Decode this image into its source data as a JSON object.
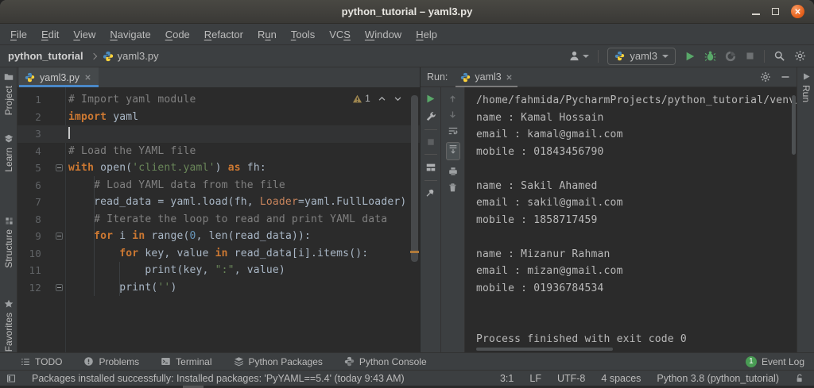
{
  "window": {
    "title": "python_tutorial – yaml3.py"
  },
  "menu": {
    "items": [
      {
        "label": "File",
        "m": 0
      },
      {
        "label": "Edit",
        "m": 0
      },
      {
        "label": "View",
        "m": 0
      },
      {
        "label": "Navigate",
        "m": 0
      },
      {
        "label": "Code",
        "m": 0
      },
      {
        "label": "Refactor",
        "m": 0
      },
      {
        "label": "Run",
        "m": 1
      },
      {
        "label": "Tools",
        "m": 0
      },
      {
        "label": "VCS",
        "m": 2
      },
      {
        "label": "Window",
        "m": 0
      },
      {
        "label": "Help",
        "m": 0
      }
    ]
  },
  "toolbar": {
    "breadcrumb_project": "python_tutorial",
    "breadcrumb_file": "yaml3.py",
    "run_config": "yaml3"
  },
  "left_bar": {
    "items": [
      "Project",
      "Learn",
      "Structure",
      "Favorites"
    ]
  },
  "right_bar": {
    "run_label": "Run"
  },
  "editor": {
    "tab_label": "yaml3.py",
    "inspection_count": "1",
    "lines": [
      {
        "n": "1",
        "segs": [
          [
            "cmt",
            "# Import yaml module"
          ]
        ]
      },
      {
        "n": "2",
        "segs": [
          [
            "kw",
            "import"
          ],
          [
            "def",
            " yaml"
          ]
        ]
      },
      {
        "n": "3",
        "segs": [],
        "current": true,
        "caret": true
      },
      {
        "n": "4",
        "segs": [
          [
            "cmt",
            "# Load the YAML file"
          ]
        ]
      },
      {
        "n": "5",
        "fold": "start",
        "segs": [
          [
            "kw",
            "with"
          ],
          [
            "def",
            " open("
          ],
          [
            "str",
            "'client.yaml'"
          ],
          [
            "def",
            ") "
          ],
          [
            "kw",
            "as"
          ],
          [
            "def",
            " fh:"
          ]
        ]
      },
      {
        "n": "6",
        "segs": [
          [
            "def",
            "    "
          ],
          [
            "cmt",
            "# Load YAML data from the file"
          ]
        ]
      },
      {
        "n": "7",
        "segs": [
          [
            "def",
            "    read_data = yaml.load(fh, "
          ],
          [
            "param",
            "Loader"
          ],
          [
            "def",
            "=yaml.FullLoader)"
          ]
        ]
      },
      {
        "n": "8",
        "segs": [
          [
            "def",
            "    "
          ],
          [
            "cmt",
            "# Iterate the loop to read and print YAML data"
          ]
        ]
      },
      {
        "n": "9",
        "fold": "start",
        "segs": [
          [
            "def",
            "    "
          ],
          [
            "kw",
            "for"
          ],
          [
            "def",
            " i "
          ],
          [
            "kw",
            "in"
          ],
          [
            "def",
            " range("
          ],
          [
            "num",
            "0"
          ],
          [
            "def",
            ", len(read_data)):"
          ]
        ]
      },
      {
        "n": "10",
        "segs": [
          [
            "def",
            "        "
          ],
          [
            "kw",
            "for"
          ],
          [
            "def",
            " key, value "
          ],
          [
            "kw",
            "in"
          ],
          [
            "def",
            " read_data[i].items():"
          ]
        ]
      },
      {
        "n": "11",
        "segs": [
          [
            "def",
            "            print(key, "
          ],
          [
            "str",
            "\":\""
          ],
          [
            "def",
            ", value)"
          ]
        ]
      },
      {
        "n": "12",
        "fold": "end",
        "segs": [
          [
            "def",
            "        print("
          ],
          [
            "str",
            "''"
          ],
          [
            "def",
            ")"
          ]
        ]
      }
    ]
  },
  "run_panel": {
    "title": "Run:",
    "tab_label": "yaml3",
    "console_lines": [
      "/home/fahmida/PycharmProjects/python_tutorial/venv/b",
      "name : Kamal Hossain",
      "email : kamal@gmail.com",
      "mobile : 01843456790",
      "",
      "name : Sakil Ahamed",
      "email : sakil@gmail.com",
      "mobile : 1858717459",
      "",
      "name : Mizanur Rahman",
      "email : mizan@gmail.com",
      "mobile : 01936784534",
      "",
      "",
      "Process finished with exit code 0"
    ]
  },
  "bottom_bar": {
    "todo": "TODO",
    "problems": "Problems",
    "terminal": "Terminal",
    "python_packages": "Python Packages",
    "python_console": "Python Console",
    "event_log": "Event Log",
    "event_count": "1"
  },
  "status_bar": {
    "message": "Packages installed successfully: Installed packages: 'PyYAML==5.4' (today 9:43 AM)",
    "caret": "3:1",
    "line_sep": "LF",
    "encoding": "UTF-8",
    "indent": "4 spaces",
    "interpreter": "Python 3.8 (python_tutorial)"
  },
  "colors": {
    "accent_blue": "#4a88c7",
    "run_green": "#59a869",
    "close_orange": "#e8641f",
    "warning_tan": "#b9945e"
  }
}
